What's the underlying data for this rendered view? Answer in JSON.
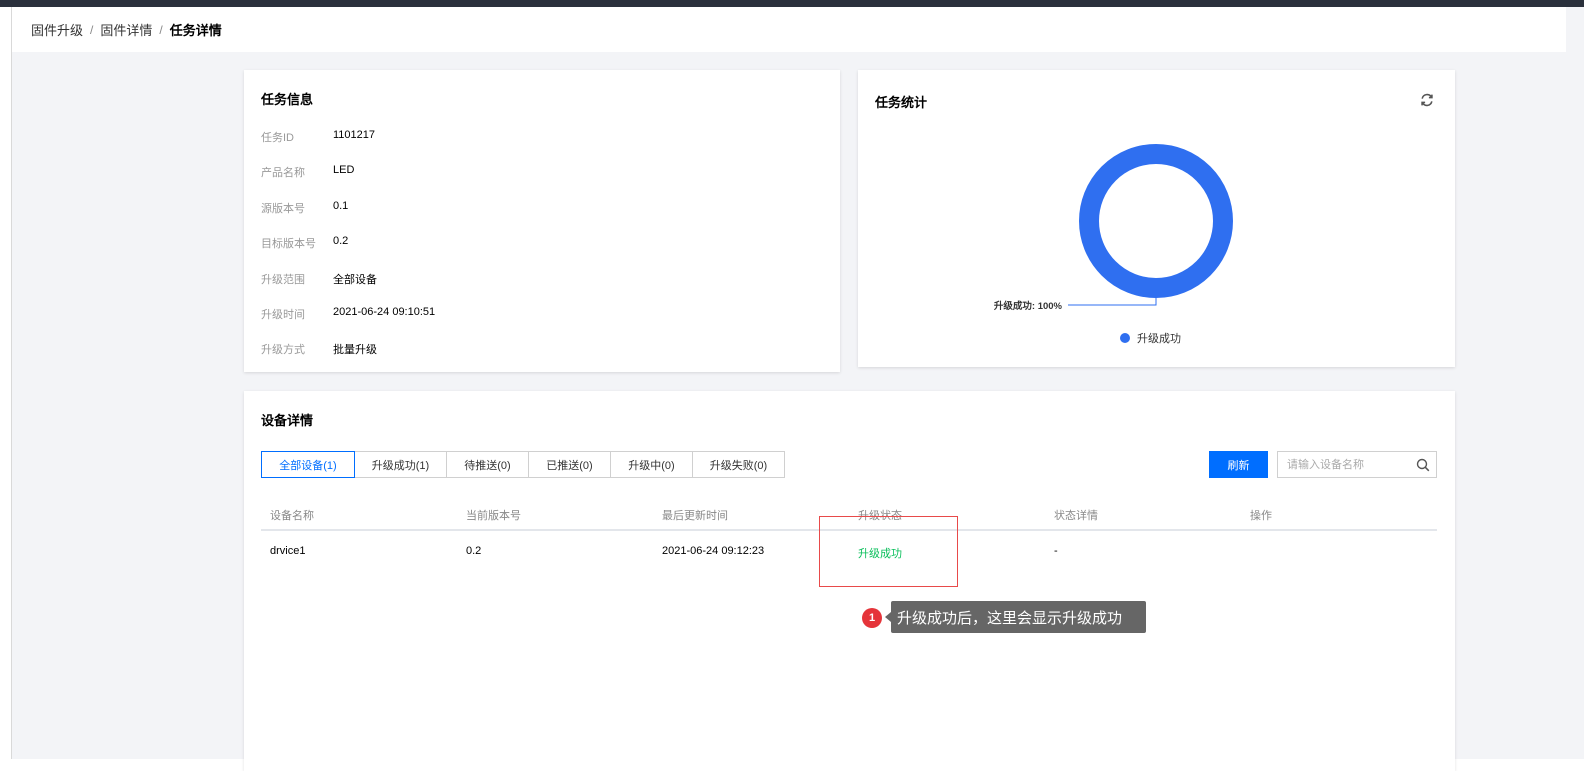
{
  "breadcrumb": {
    "items": [
      "固件升级",
      "固件详情"
    ],
    "separator": "/",
    "current": "任务详情"
  },
  "task_info": {
    "title": "任务信息",
    "rows": [
      {
        "label": "任务ID",
        "value": "1101217"
      },
      {
        "label": "产品名称",
        "value": "LED"
      },
      {
        "label": "源版本号",
        "value": "0.1"
      },
      {
        "label": "目标版本号",
        "value": "0.2"
      },
      {
        "label": "升级范围",
        "value": "全部设备"
      },
      {
        "label": "升级时间",
        "value": "2021-06-24 09:10:51"
      },
      {
        "label": "升级方式",
        "value": "批量升级"
      }
    ]
  },
  "task_stats": {
    "title": "任务统计",
    "refresh_icon": "refresh-icon"
  },
  "chart_data": {
    "type": "pie",
    "donut": true,
    "categories": [
      "升级成功"
    ],
    "values": [
      100
    ],
    "data_labels": [
      "升级成功: 100%"
    ],
    "colors": [
      "#2f6ff0"
    ],
    "legend": {
      "placement": "bottom",
      "entries": [
        "升级成功"
      ]
    }
  },
  "device_details": {
    "title": "设备详情",
    "tabs": [
      {
        "label": "全部设备(1)",
        "active": true
      },
      {
        "label": "升级成功(1)",
        "active": false
      },
      {
        "label": "待推送(0)",
        "active": false
      },
      {
        "label": "已推送(0)",
        "active": false
      },
      {
        "label": "升级中(0)",
        "active": false
      },
      {
        "label": "升级失败(0)",
        "active": false
      }
    ],
    "refresh_button": "刷新",
    "search_placeholder": "请输入设备名称",
    "columns": [
      "设备名称",
      "当前版本号",
      "最后更新时间",
      "升级状态",
      "状态详情",
      "操作"
    ],
    "rows": [
      {
        "name": "drvice1",
        "version": "0.2",
        "updated": "2021-06-24 09:12:23",
        "status": "升级成功",
        "status_detail": "-",
        "action": ""
      }
    ],
    "status_color": "#0abf5b"
  },
  "annotation": {
    "number": "1",
    "text": "升级成功后，这里会显示升级成功"
  },
  "colors": {
    "accent": "#006eff",
    "chart": "#2f6ff0",
    "annotation_badge": "#e5343a",
    "highlight": "#e84a4a"
  }
}
